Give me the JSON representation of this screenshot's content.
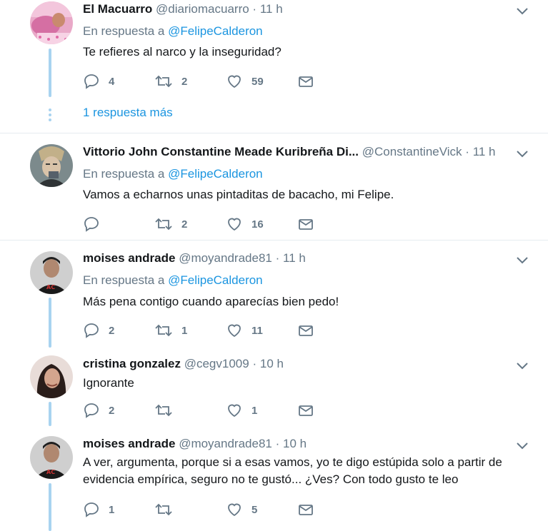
{
  "tweets": [
    {
      "name": "El Macuarro",
      "handle": "@diariomacuarro",
      "time": "11 h",
      "reply_prefix": "En respuesta a",
      "reply_to": "@FelipeCalderon",
      "text": "Te refieres al narco y la inseguridad?",
      "replies": "4",
      "retweets": "2",
      "likes": "59",
      "more_replies": "1 respuesta más"
    },
    {
      "name": "Vittorio John Constantine Meade Kuribreña Di...",
      "handle": "@ConstantineVick",
      "time": "11 h",
      "reply_prefix": "En respuesta a",
      "reply_to": "@FelipeCalderon",
      "text": "Vamos a echarnos unas pintaditas de bacacho, mi Felipe.",
      "replies": "",
      "retweets": "2",
      "likes": "16"
    },
    {
      "name": "moises andrade",
      "handle": "@moyandrade81",
      "time": "11 h",
      "reply_prefix": "En respuesta a",
      "reply_to": "@FelipeCalderon",
      "text": "Más pena contigo cuando aparecías bien pedo!",
      "replies": "2",
      "retweets": "1",
      "likes": "11"
    },
    {
      "name": "cristina gonzalez",
      "handle": "@cegv1009",
      "time": "10 h",
      "text": "Ignorante",
      "replies": "2",
      "retweets": "",
      "likes": "1"
    },
    {
      "name": "moises andrade",
      "handle": "@moyandrade81",
      "time": "10 h",
      "text": "A ver, argumenta, porque si a esas vamos, yo te digo estúpida solo a partir de evidencia empírica, seguro no te gustó... ¿Ves? Con todo gusto te leo",
      "replies": "1",
      "retweets": "",
      "likes": "5"
    }
  ],
  "separator": "·",
  "icons": {
    "reply": "reply-icon",
    "retweet": "retweet-icon",
    "like": "heart-icon",
    "dm": "envelope-icon",
    "menu": "chevron-down-icon"
  },
  "colors": {
    "link": "#1b95e0",
    "muted": "#657786",
    "thread": "#a8d3f0",
    "divider": "#e6ecf0"
  }
}
